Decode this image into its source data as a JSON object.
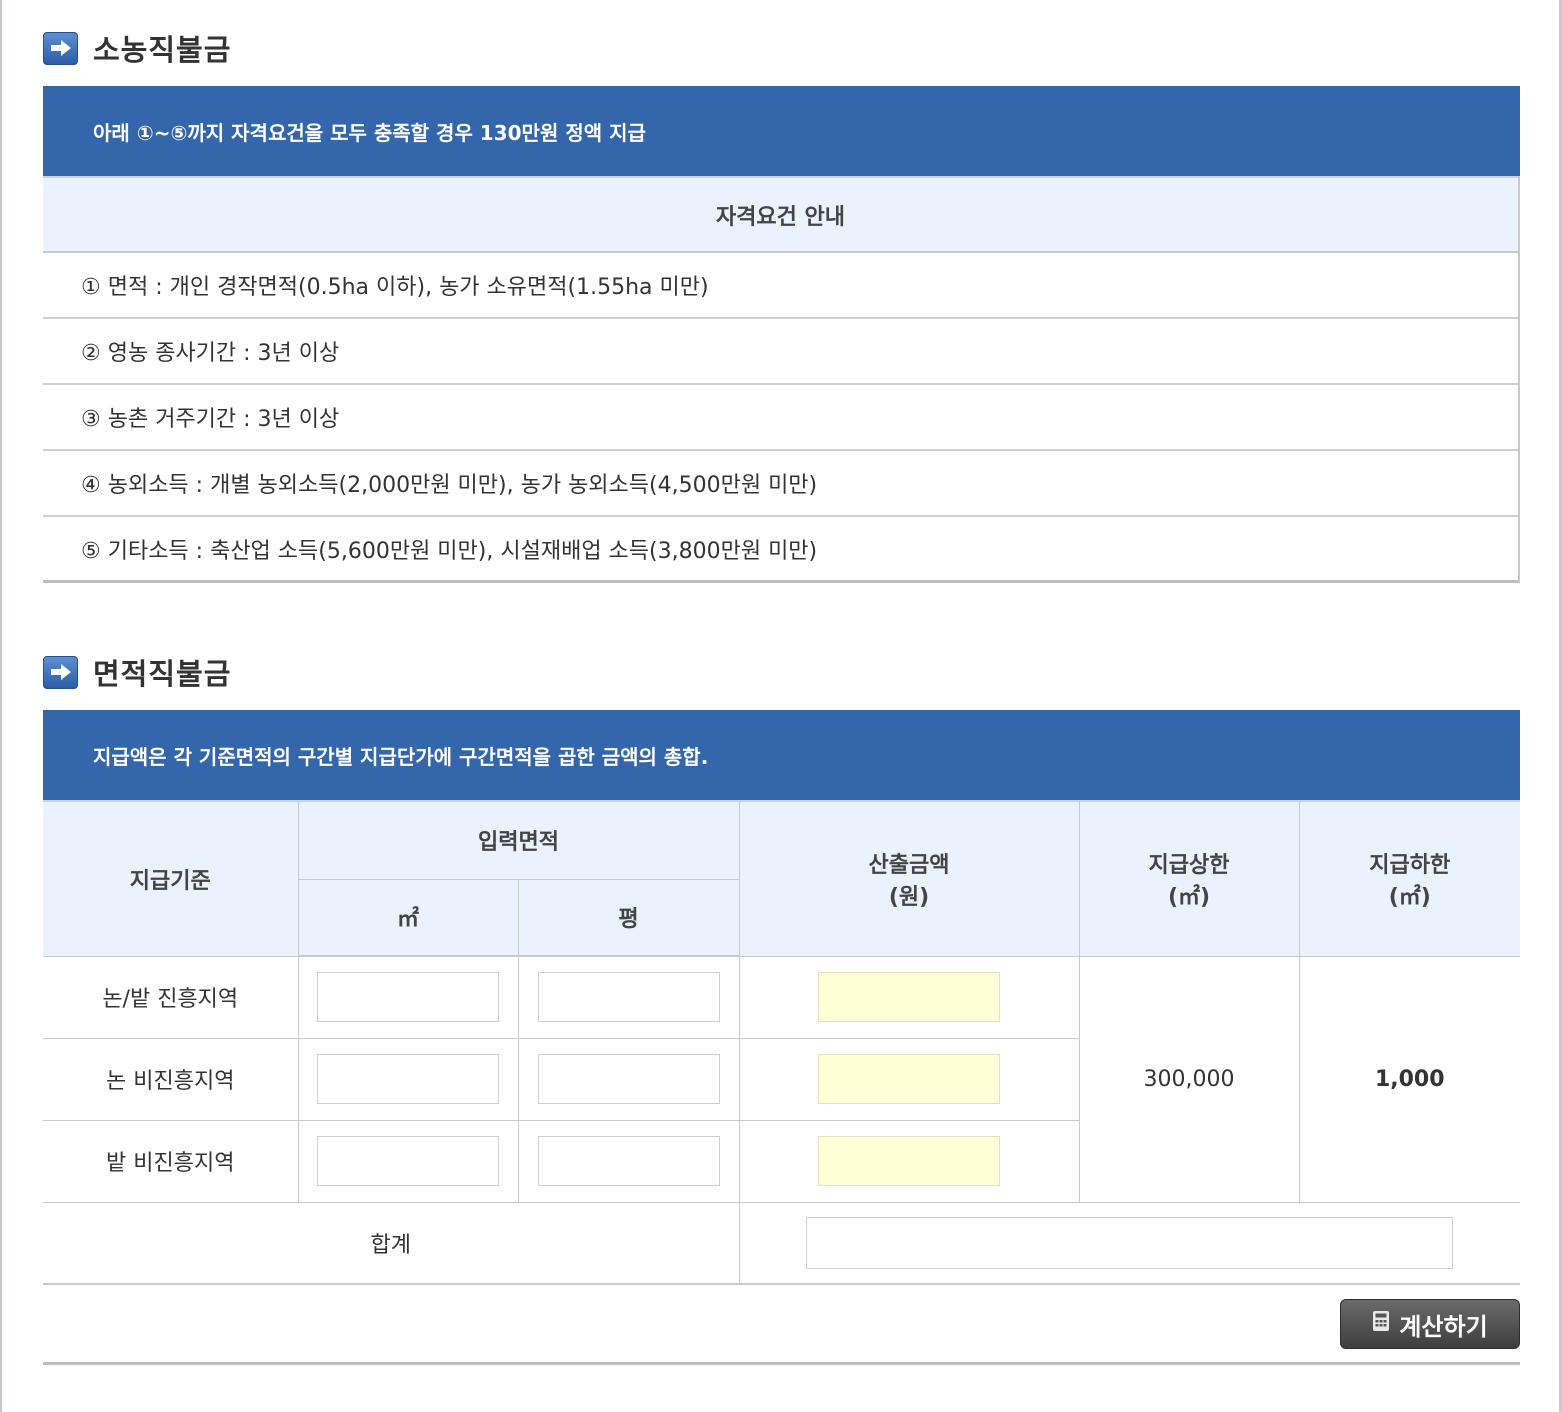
{
  "section1": {
    "title": "소농직불금",
    "banner": "아래 ①~⑤까지 자격요건을 모두 충족할 경우 130만원 정액 지급",
    "requirements_header": "자격요건 안내",
    "requirements": [
      "① 면적 : 개인 경작면적(0.5ha 이하), 농가 소유면적(1.55ha 미만)",
      "② 영농 종사기간 : 3년 이상",
      "③ 농촌 거주기간 : 3년 이상",
      "④ 농외소득 : 개별 농외소득(2,000만원 미만), 농가 농외소득(4,500만원 미만)",
      "⑤ 기타소득 : 축산업 소득(5,600만원 미만), 시설재배업 소득(3,800만원 미만)"
    ]
  },
  "section2": {
    "title": "면적직불금",
    "banner": "지급액은 각 기준면적의 구간별 지급단가에 구간면적을 곱한 금액의 총합.",
    "headers": {
      "criteria": "지급기준",
      "input_area": "입력면적",
      "m2": "㎡",
      "pyeong": "평",
      "amount": "산출금액",
      "amount_unit": "(원)",
      "upper": "지급상한",
      "upper_unit": "(㎡)",
      "lower": "지급하한",
      "lower_unit": "(㎡)"
    },
    "rows": [
      {
        "label": "논/밭 진흥지역",
        "m2": "",
        "pyeong": "",
        "amount": ""
      },
      {
        "label": "논 비진흥지역",
        "m2": "",
        "pyeong": "",
        "amount": ""
      },
      {
        "label": "밭 비진흥지역",
        "m2": "",
        "pyeong": "",
        "amount": ""
      }
    ],
    "upper_limit": "300,000",
    "lower_limit": "1,000",
    "total_label": "합계",
    "total_value": "",
    "calc_button": "계산하기"
  },
  "colors": {
    "banner": "#3366aa",
    "header_bg": "#eaf3fd",
    "result_field": "#ffffd6",
    "lower_limit_text": "#b45f06"
  },
  "icons": [
    "arrow-right-icon",
    "calculator-icon"
  ]
}
